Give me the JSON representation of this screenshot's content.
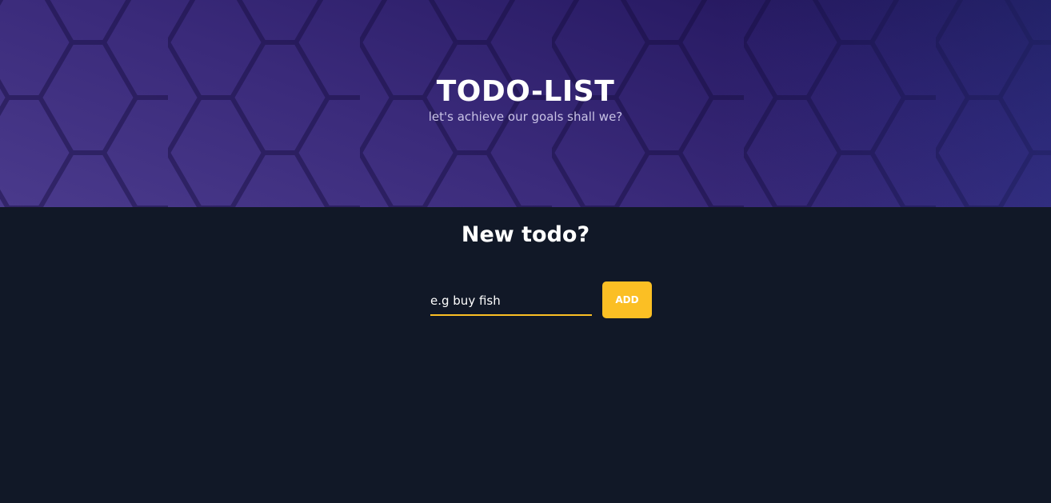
{
  "hero": {
    "title": "TODO-LIST",
    "subtitle": "let's achieve our goals shall we?",
    "background_colors": [
      "#4a3a8c",
      "#2a1c66",
      "#1d1250"
    ],
    "pattern": "hexagon-grid"
  },
  "form": {
    "heading": "New todo?",
    "input_placeholder": "e.g buy fish",
    "add_label": "ADD",
    "accent_color": "#fbbf24"
  },
  "colors": {
    "page_background": "#111827",
    "text": "#ffffff"
  }
}
